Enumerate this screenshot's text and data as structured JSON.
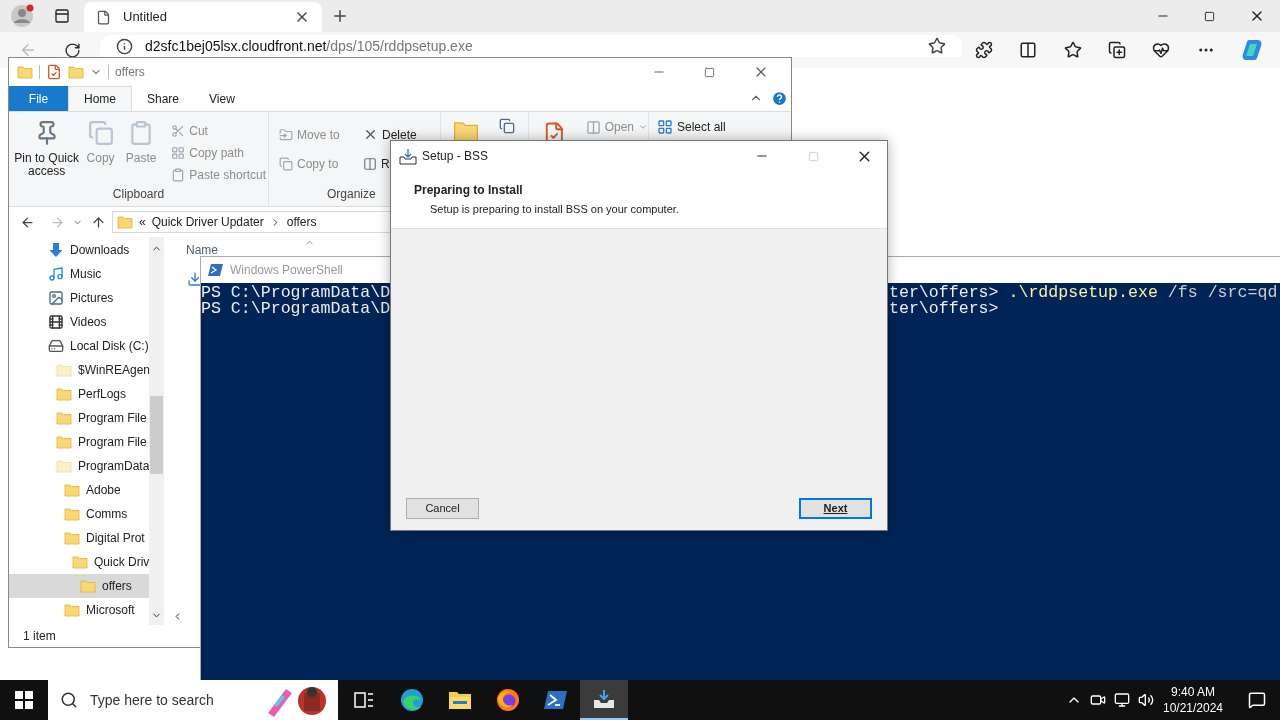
{
  "browser": {
    "tab": {
      "title": "Untitled"
    },
    "address": {
      "host": "d2sfc1bej05lsx.cloudfront.net",
      "path": "/dps/105/rddpsetup.exe"
    }
  },
  "explorer": {
    "title": "offers",
    "ribbon_tabs": [
      {
        "label": "File",
        "kind": "file",
        "selected": false
      },
      {
        "label": "Home",
        "kind": "plain",
        "selected": true
      },
      {
        "label": "Share",
        "kind": "plain",
        "selected": false
      },
      {
        "label": "View",
        "kind": "plain",
        "selected": false
      }
    ],
    "clipboard": {
      "label": "Clipboard",
      "large": [
        {
          "label": "Pin to Quick access",
          "disabled": false
        },
        {
          "label": "Copy",
          "disabled": true
        },
        {
          "label": "Paste",
          "disabled": true
        }
      ],
      "small": [
        {
          "label": "Cut",
          "disabled": true
        },
        {
          "label": "Copy path",
          "disabled": true
        },
        {
          "label": "Paste shortcut",
          "disabled": true
        }
      ]
    },
    "organize": {
      "label": "Organize",
      "items": [
        {
          "label": "Move to",
          "disabled": true
        },
        {
          "label": "Delete",
          "disabled": false
        },
        {
          "label": "Copy to",
          "disabled": true
        },
        {
          "label": "R",
          "disabled": false
        }
      ]
    },
    "open": {
      "label": "Open",
      "disabled": true
    },
    "select": {
      "label": "Select all",
      "disabled": false
    },
    "breadcrumb": {
      "overflow": "«",
      "parts": [
        "Quick Driver Updater",
        "offers"
      ]
    },
    "nav_tree": [
      {
        "label": "Downloads",
        "kind": "downloads",
        "selected": false
      },
      {
        "label": "Music",
        "kind": "music",
        "selected": false
      },
      {
        "label": "Pictures",
        "kind": "pictures",
        "selected": false
      },
      {
        "label": "Videos",
        "kind": "videos",
        "selected": false
      },
      {
        "label": "Local Disk (C:)",
        "kind": "drive",
        "selected": false,
        "children": [
          {
            "label": "$WinREAgen",
            "kind": "hidden-folder",
            "selected": false
          },
          {
            "label": "PerfLogs",
            "kind": "folder",
            "selected": false
          },
          {
            "label": "Program File",
            "kind": "folder",
            "selected": false
          },
          {
            "label": "Program File",
            "kind": "folder",
            "selected": false
          },
          {
            "label": "ProgramData",
            "kind": "hidden-folder",
            "selected": false,
            "children": [
              {
                "label": "Adobe",
                "kind": "folder",
                "selected": false
              },
              {
                "label": "Comms",
                "kind": "folder",
                "selected": false
              },
              {
                "label": "Digital Prot",
                "kind": "folder",
                "selected": false,
                "children": [
                  {
                    "label": "Quick Driv",
                    "kind": "folder",
                    "selected": false,
                    "children": [
                      {
                        "label": "offers",
                        "kind": "folder",
                        "selected": true
                      }
                    ]
                  }
                ]
              },
              {
                "label": "Microsoft",
                "kind": "folder",
                "selected": false
              }
            ]
          }
        ]
      }
    ],
    "column_header": "Name",
    "status": "1 item"
  },
  "powershell": {
    "title": "Windows PowerShell",
    "lines": [
      {
        "left": "PS C:\\ProgramData\\D",
        "right": [
          {
            "kind": "prompt",
            "text": "ter\\offers> "
          },
          {
            "kind": "command",
            "text": ".\\rddpsetup.exe"
          },
          {
            "kind": "argument",
            "text": " /fs /src=qd"
          }
        ]
      },
      {
        "left": "PS C:\\ProgramData\\D",
        "right": [
          {
            "kind": "prompt",
            "text": "ter\\offers>"
          }
        ]
      }
    ]
  },
  "setup": {
    "title": "Setup - BSS",
    "heading": "Preparing to Install",
    "subheading": "Setup is preparing to install BSS on your computer.",
    "buttons": [
      {
        "label": "Cancel",
        "default": false
      },
      {
        "label": "Next",
        "default": true
      }
    ]
  },
  "taskbar": {
    "search": {
      "placeholder": "Type here to search"
    },
    "apps": [
      {
        "kind": "task-view",
        "active": false
      },
      {
        "kind": "edge",
        "active": false
      },
      {
        "kind": "explorer",
        "active": false
      },
      {
        "kind": "firefox",
        "active": false
      },
      {
        "kind": "powershell",
        "active": false
      },
      {
        "kind": "setup",
        "active": true
      }
    ],
    "time": "9:40 AM",
    "date": "10/21/2024"
  }
}
